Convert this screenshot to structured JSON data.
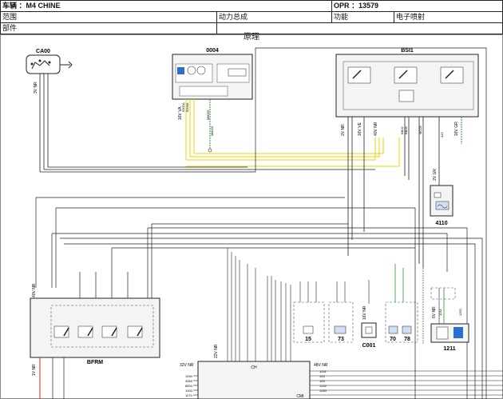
{
  "header": {
    "vehicle": "车辆 ：M4 CHINE",
    "opr": "OPR ：13579",
    "scope_label": "范围",
    "scope_value": "动力总成",
    "function_label": "功能",
    "function_value": "电子喷射",
    "part_label": "部件"
  },
  "diagram": {
    "title": "原理",
    "components": {
      "ca00": "CA00",
      "c0004": "0004",
      "bsi1": "BSI1",
      "c4110": "4110",
      "bfrm": "BFRM",
      "c1211": "1211",
      "c001": "C001",
      "c15": "15",
      "c73": "73",
      "c70": "70",
      "c78": "78"
    },
    "connectors": {
      "ca00": "3V NR",
      "c0004": "16V VA",
      "bsi1_a": "2V NR",
      "bsi1_b": "16V VE",
      "bsi1_c": "40V NR",
      "bsi1_d": "16V GR",
      "c4110": "2V GR",
      "bfrm": "40V NR",
      "ecu_a": "22V NR",
      "ecu_b": "32V NR",
      "ecu_c": "48V NR",
      "c001": "16V NR",
      "c1211": "6V NR",
      "bfrm_bottom": "1V NR",
      "ecu_ch": "CH",
      "ecu_cmi": "CMI"
    },
    "wires": {
      "w1": "5002A",
      "w2": "5003A",
      "w3": "M8025",
      "w4": "M8025",
      "w5": "BB02",
      "w6": "BB03",
      "w7": "MC05",
      "w8": "419",
      "w9": "1211",
      "w10": "1252"
    },
    "labels": {
      "ecu_pins": [
        "1094",
        "3069",
        "8004",
        "1003",
        "1179"
      ],
      "ecu_pins_r": [
        "1241",
        "123",
        "125",
        "1242",
        "1263"
      ]
    }
  }
}
